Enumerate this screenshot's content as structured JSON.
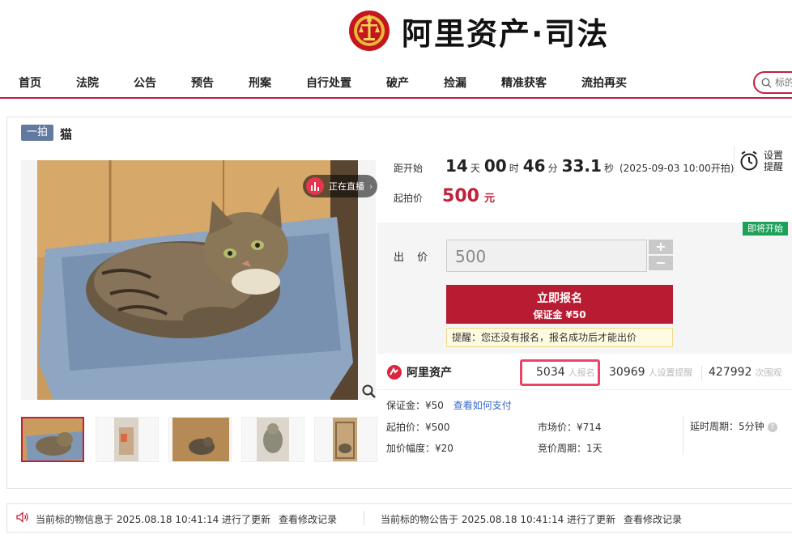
{
  "header": {
    "site_title": "阿里资产·司法"
  },
  "nav": {
    "items": [
      "首页",
      "法院",
      "公告",
      "预告",
      "刑案",
      "自行处置",
      "破产",
      "捡漏",
      "精准获客",
      "流拍再买"
    ],
    "search_placeholder": "标的"
  },
  "item": {
    "badge": "一拍",
    "title": "猫",
    "live_label": "正在直播"
  },
  "countdown": {
    "label": "距开始",
    "days": "14",
    "days_unit": "天",
    "hours": "00",
    "hours_unit": "时",
    "minutes": "46",
    "minutes_unit": "分",
    "seconds": "33.1",
    "seconds_unit": "秒",
    "start_note": "(2025-09-03 10:00开拍)"
  },
  "reminder": {
    "label_line1": "设置",
    "label_line2": "提醒"
  },
  "start_price": {
    "label": "起拍价",
    "value": "500",
    "unit": "元"
  },
  "bid": {
    "status_tag": "即将开始",
    "label": "出 价",
    "input_placeholder": "500",
    "plus": "+",
    "minus": "−",
    "apply_main": "立即报名",
    "apply_sub": "保证金 ¥50",
    "tip": "提醒：您还没有报名，报名成功后才能出价"
  },
  "stats": {
    "brand": "阿里资产",
    "signups": "5034",
    "signups_label": "人报名",
    "reminders": "30969",
    "reminders_label": "人设置提醒",
    "views": "427992",
    "views_label": "次围观"
  },
  "details": {
    "deposit": "保证金：¥50",
    "deposit_link": "查看如何支付",
    "start_price": "起拍价：¥500",
    "market_price": "市场价：¥714",
    "delay": "延时周期：5分钟",
    "increment": "加价幅度：¥20",
    "bid_period": "竞价周期：1天"
  },
  "notices": {
    "item_info": "当前标的物信息于 2025.08.18 10:41:14 进行了更新",
    "item_info_link": "查看修改记录",
    "announcement": "当前标的物公告于 2025.08.18 10:41:14 进行了更新",
    "announcement_link": "查看修改记录"
  },
  "colors": {
    "brand_red": "#c0213b",
    "apply_red": "#b81c32",
    "status_green": "#1da05a",
    "badge_blue": "#6279a0",
    "link_blue": "#3768c7"
  }
}
